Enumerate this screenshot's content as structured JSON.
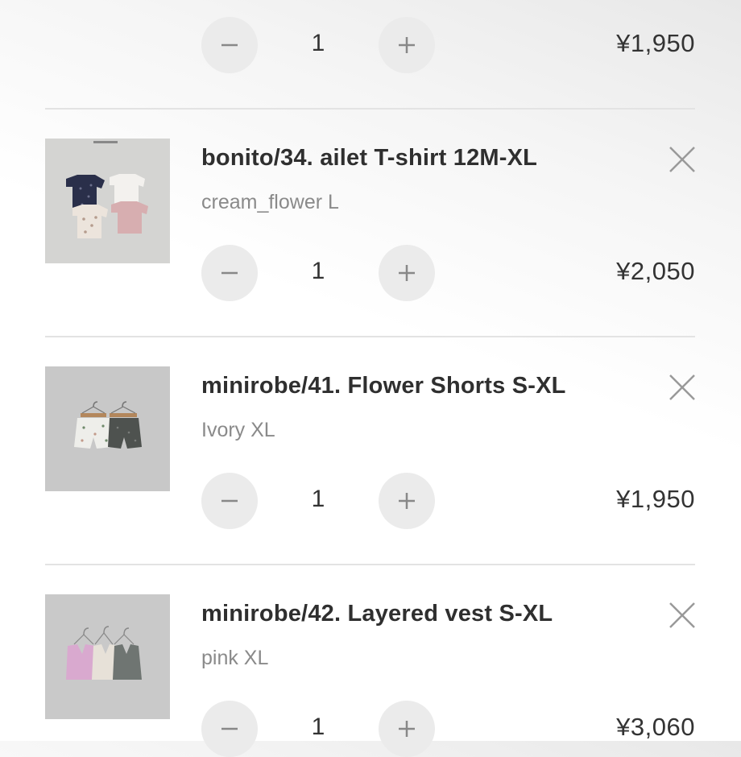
{
  "cart": {
    "items": [
      {
        "title": "",
        "variant": "",
        "quantity": "1",
        "price": "¥1,950",
        "thumb_icon": "product-photo"
      },
      {
        "title": "bonito/34. ailet T-shirt 12M-XL",
        "variant": "cream_flower L",
        "quantity": "1",
        "price": "¥2,050",
        "thumb_icon": "tshirts-photo"
      },
      {
        "title": "minirobe/41. Flower Shorts S-XL",
        "variant": "Ivory XL",
        "quantity": "1",
        "price": "¥1,950",
        "thumb_icon": "shorts-photo"
      },
      {
        "title": "minirobe/42. Layered vest S-XL",
        "variant": "pink XL",
        "quantity": "1",
        "price": "¥3,060",
        "thumb_icon": "vests-photo"
      }
    ]
  },
  "colors": {
    "button_bg": "#ebebeb",
    "divider": "#e3e3e3",
    "variant_text": "#8a8a8a",
    "title_text": "#2f2f2f"
  }
}
